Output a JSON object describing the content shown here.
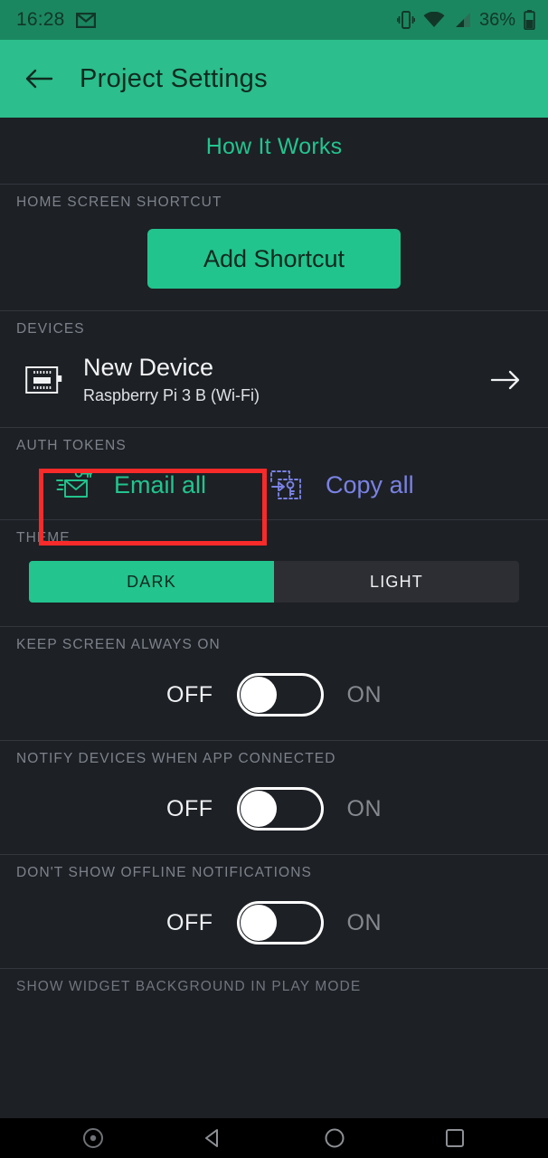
{
  "status_bar": {
    "time": "16:28",
    "gmail_icon": "gmail-icon",
    "vibrate_icon": "vibrate-icon",
    "wifi_icon": "wifi-icon",
    "cellular_icon": "cellular-signal-icon",
    "battery_percent": "36%",
    "battery_icon": "battery-icon",
    "background": "#1b8761"
  },
  "app_bar": {
    "back_icon": "back-arrow-icon",
    "title": "Project Settings",
    "background": "#2cbe8c"
  },
  "content": {
    "how_it_works": "How It Works",
    "accent_green": "#23c48e",
    "copy_blue": "#7a82e3",
    "highlight_red": "#f82a2a",
    "background": "#1d2025"
  },
  "home_shortcut": {
    "label": "HOME SCREEN SHORTCUT",
    "button_label": "Add Shortcut"
  },
  "devices": {
    "label": "DEVICES",
    "icon": "microcontroller-board-icon",
    "name": "New Device",
    "subtitle": "Raspberry Pi 3 B (Wi-Fi)",
    "chevron_icon": "arrow-right-icon"
  },
  "auth_tokens": {
    "label": "AUTH TOKENS",
    "email_icon": "email-key-icon",
    "email_label": "Email all",
    "copy_icon": "copy-key-icon",
    "copy_label": "Copy all"
  },
  "theme": {
    "label": "THEME",
    "options": [
      {
        "label": "DARK",
        "selected": true
      },
      {
        "label": "LIGHT",
        "selected": false
      }
    ]
  },
  "toggles": [
    {
      "label": "KEEP SCREEN ALWAYS ON",
      "off_label": "OFF",
      "on_label": "ON",
      "state": "off"
    },
    {
      "label": "NOTIFY DEVICES WHEN APP CONNECTED",
      "off_label": "OFF",
      "on_label": "ON",
      "state": "off"
    },
    {
      "label": "DON'T SHOW OFFLINE NOTIFICATIONS",
      "off_label": "OFF",
      "on_label": "ON",
      "state": "off"
    }
  ],
  "partial_section": {
    "label": "SHOW WIDGET BACKGROUND IN PLAY MODE"
  },
  "nav_bar": {
    "items": [
      {
        "icon": "screen-record-icon"
      },
      {
        "icon": "back-triangle-icon"
      },
      {
        "icon": "home-circle-icon"
      },
      {
        "icon": "recents-square-icon"
      }
    ]
  }
}
